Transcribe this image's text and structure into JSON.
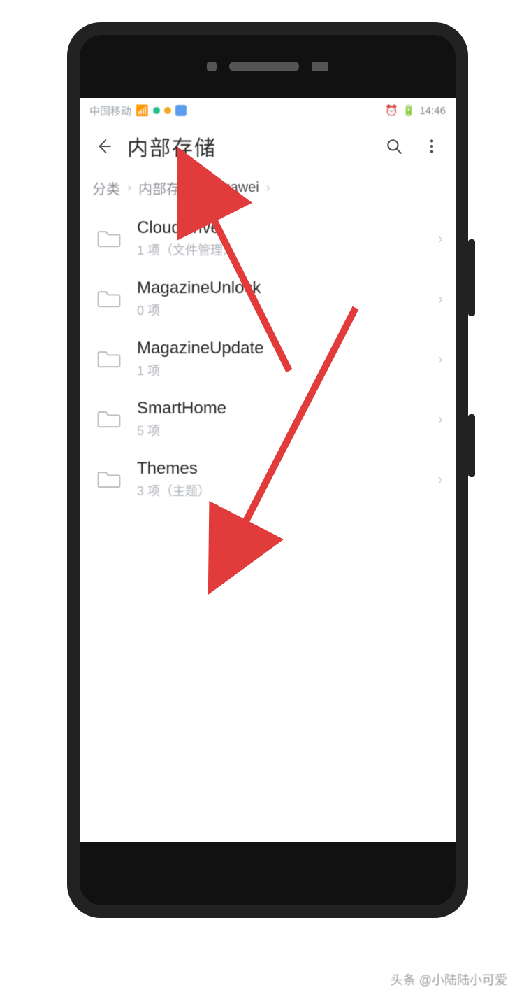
{
  "status": {
    "carrier": "中国移动",
    "time": "14:46"
  },
  "header": {
    "title": "内部存储"
  },
  "breadcrumb": {
    "items": [
      "分类",
      "内部存储",
      "Huawei"
    ]
  },
  "folders": [
    {
      "name": "CloudDrive",
      "sub": "1 项（文件管理）"
    },
    {
      "name": "MagazineUnlock",
      "sub": "0 项"
    },
    {
      "name": "MagazineUpdate",
      "sub": "1 项"
    },
    {
      "name": "SmartHome",
      "sub": "5 项"
    },
    {
      "name": "Themes",
      "sub": "3 项（主题）"
    }
  ],
  "watermark": "头条 @小陆陆小可爱",
  "colors": {
    "arrow": "#e23b3b"
  }
}
